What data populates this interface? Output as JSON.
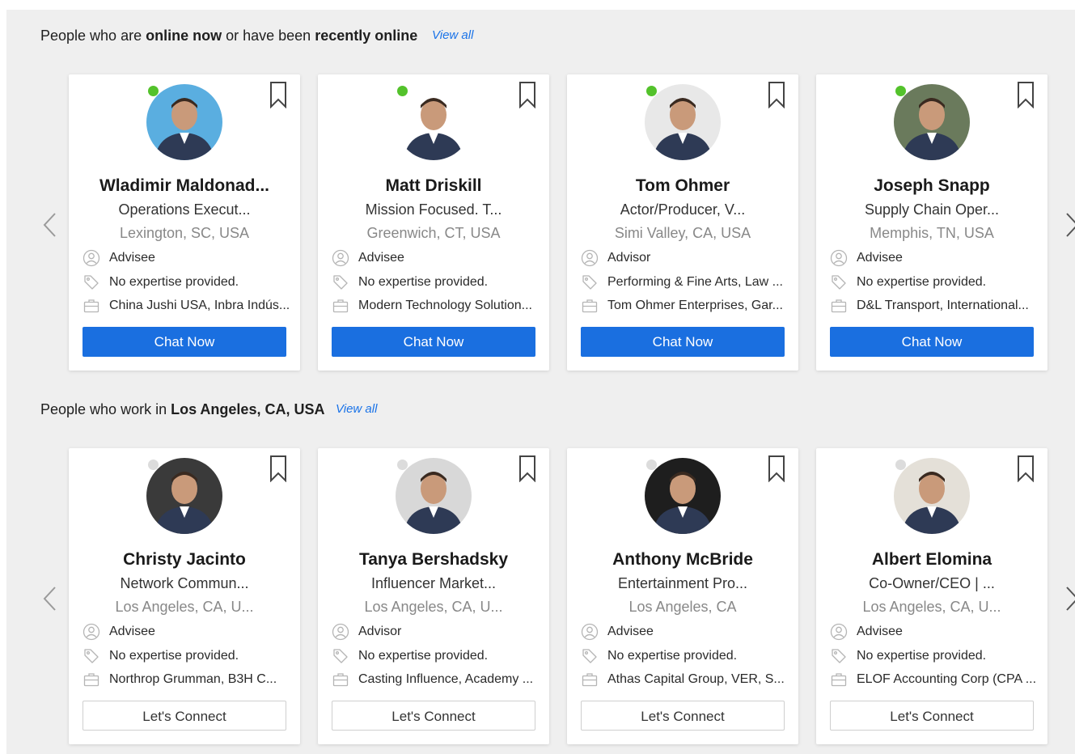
{
  "sections": [
    {
      "title_parts": [
        "People who are ",
        "online now",
        " or have been ",
        "recently online"
      ],
      "view_all": "View all",
      "button_label": "Chat Now",
      "people": [
        {
          "name": "Wladimir Maldonad...",
          "title": "Operations Execut...",
          "location": "Lexington, SC, USA",
          "role": "Advisee",
          "expertise": "No expertise provided.",
          "company": "China Jushi USA, Inbra Indús...",
          "online": true
        },
        {
          "name": "Matt Driskill",
          "title": "Mission Focused. T...",
          "location": "Greenwich, CT, USA",
          "role": "Advisee",
          "expertise": "No expertise provided.",
          "company": "Modern Technology Solution...",
          "online": true
        },
        {
          "name": "Tom Ohmer",
          "title": "Actor/Producer, V...",
          "location": "Simi Valley, CA, USA",
          "role": "Advisor",
          "expertise": "Performing & Fine Arts, Law ...",
          "company": "Tom Ohmer Enterprises, Gar...",
          "online": true
        },
        {
          "name": "Joseph Snapp",
          "title": "Supply Chain Oper...",
          "location": "Memphis, TN, USA",
          "role": "Advisee",
          "expertise": "No expertise provided.",
          "company": "D&L Transport, International...",
          "online": true
        }
      ]
    },
    {
      "title_parts": [
        "People who work in ",
        "Los Angeles, CA, USA"
      ],
      "view_all": "View all",
      "button_label": "Let's Connect",
      "people": [
        {
          "name": "Christy Jacinto",
          "title": "Network Commun...",
          "location": "Los Angeles, CA, U...",
          "role": "Advisee",
          "expertise": "No expertise provided.",
          "company": "Northrop Grumman, B3H C...",
          "online": false
        },
        {
          "name": "Tanya Bershadsky",
          "title": "Influencer Market...",
          "location": "Los Angeles, CA, U...",
          "role": "Advisor",
          "expertise": "No expertise provided.",
          "company": "Casting Influence, Academy ...",
          "online": false
        },
        {
          "name": "Anthony McBride",
          "title": "Entertainment Pro...",
          "location": "Los Angeles, CA",
          "role": "Advisee",
          "expertise": "No expertise provided.",
          "company": "Athas Capital Group, VER, S...",
          "online": false
        },
        {
          "name": "Albert Elomina",
          "title": "Co-Owner/CEO | ...",
          "location": "Los Angeles, CA, U...",
          "role": "Advisee",
          "expertise": "No expertise provided.",
          "company": "ELOF Accounting Corp (CPA ...",
          "online": false
        }
      ]
    }
  ],
  "colors": {
    "accent": "#1a6fe0",
    "link": "#1a73e8",
    "online": "#53c22b",
    "offline": "#dcdcdc"
  },
  "icons": [
    "bookmark-icon",
    "user-icon",
    "tag-icon",
    "briefcase-icon",
    "chevron-left-icon",
    "chevron-right-icon"
  ]
}
